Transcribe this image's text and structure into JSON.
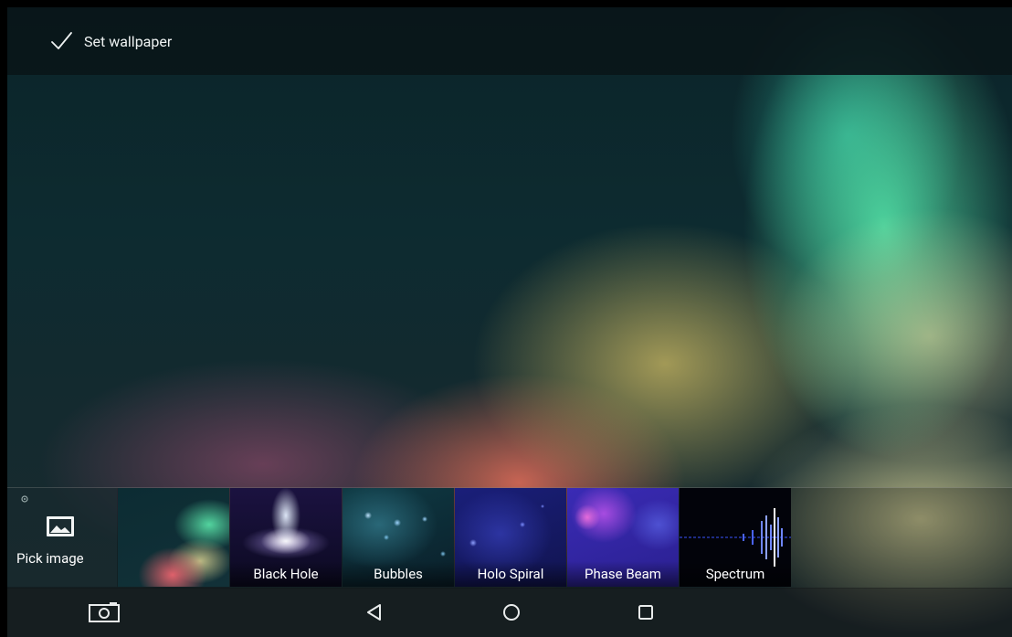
{
  "action_bar": {
    "set_wallpaper_label": "Set wallpaper",
    "icon": "check-icon"
  },
  "tray": {
    "pick_image_label": "Pick image",
    "pick_icon": "image-icon",
    "wallpapers": [
      {
        "label": ""
      },
      {
        "label": "Black Hole"
      },
      {
        "label": "Bubbles"
      },
      {
        "label": "Holo Spiral"
      },
      {
        "label": "Phase Beam"
      },
      {
        "label": "Spectrum"
      }
    ]
  },
  "nav": {
    "screenshot_icon": "camera-icon",
    "back_icon": "back-triangle-icon",
    "home_icon": "home-circle-icon",
    "recents_icon": "recents-square-icon"
  },
  "colors": {
    "action_bar_bg": "#0a1619",
    "text": "#eef2f2",
    "accent_green": "#56e8aa",
    "accent_red": "#e66e5a"
  }
}
